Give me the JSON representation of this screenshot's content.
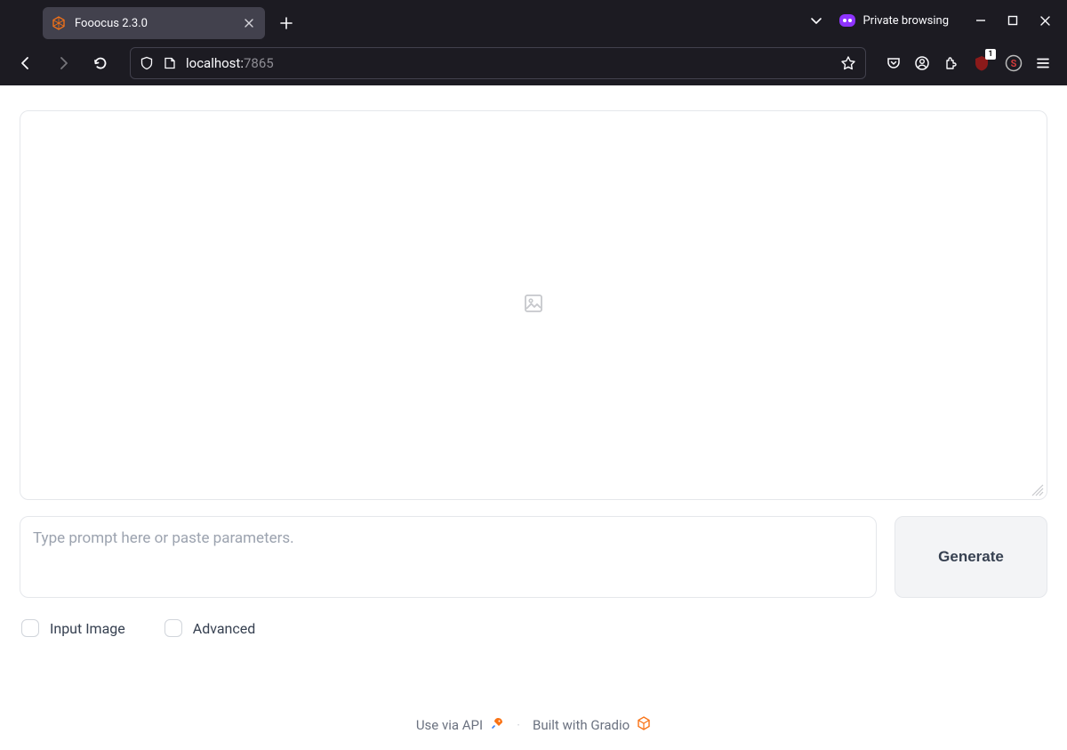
{
  "browser": {
    "tab_title": "Fooocus 2.3.0",
    "private_label": "Private browsing",
    "url_host": "localhost:",
    "url_port": "7865",
    "ext_badge": "1"
  },
  "page": {
    "prompt_placeholder": "Type prompt here or paste parameters.",
    "generate_label": "Generate",
    "checkbox_input_image": "Input Image",
    "checkbox_advanced": "Advanced",
    "footer_api": "Use via API",
    "footer_gradio": "Built with Gradio"
  }
}
